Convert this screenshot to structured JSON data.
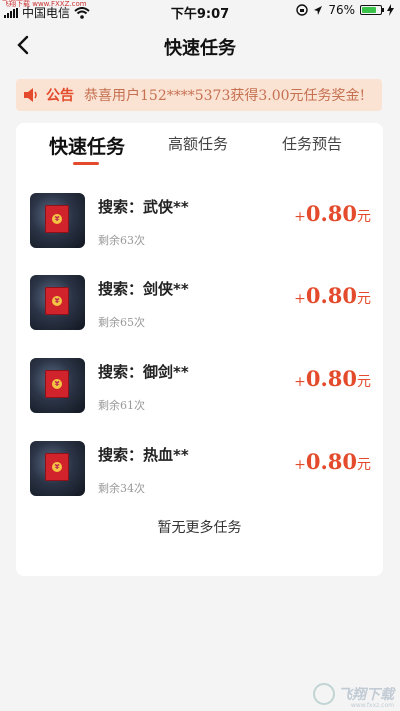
{
  "status_bar": {
    "watermark": "飞翔下载 www.FXXZ.com",
    "carrier": "中国电信",
    "time": "下午9:07",
    "battery": "76%",
    "battery_level": 0.76
  },
  "nav": {
    "title": "快速任务"
  },
  "notice": {
    "label": "公告",
    "text": "恭喜用户152****5373获得3.00元任务奖金!"
  },
  "tabs": [
    {
      "label": "快速任务",
      "active": true
    },
    {
      "label": "高额任务",
      "active": false
    },
    {
      "label": "任务预告",
      "active": false
    }
  ],
  "tasks": [
    {
      "title": "搜索：武侠**",
      "remaining": "剩余63次",
      "plus": "+",
      "amount": "0.80",
      "unit": "元"
    },
    {
      "title": "搜索：剑侠**",
      "remaining": "剩余65次",
      "plus": "+",
      "amount": "0.80",
      "unit": "元"
    },
    {
      "title": "搜索：御剑**",
      "remaining": "剩余61次",
      "plus": "+",
      "amount": "0.80",
      "unit": "元"
    },
    {
      "title": "搜索：热血**",
      "remaining": "剩余34次",
      "plus": "+",
      "amount": "0.80",
      "unit": "元"
    }
  ],
  "footer": {
    "no_more": "暂无更多任务"
  },
  "watermark": {
    "text": "飞翔下载",
    "sub": "www.fxxz.com"
  },
  "colors": {
    "accent": "#e44b2c",
    "notice_bg": "#fbe3d4",
    "page_bg": "#f4f4f4"
  }
}
